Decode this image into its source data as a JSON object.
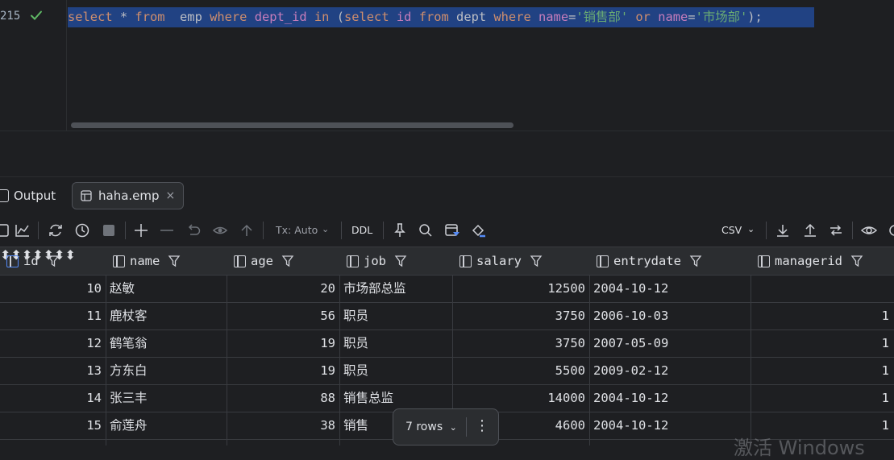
{
  "editor": {
    "line_number": "215",
    "code_tokens": [
      {
        "t": "select",
        "c": "kw"
      },
      {
        "t": " * ",
        "c": "op"
      },
      {
        "t": "from",
        "c": "kw"
      },
      {
        "t": "  emp ",
        "c": "id"
      },
      {
        "t": "where",
        "c": "kw"
      },
      {
        "t": " ",
        "c": "op"
      },
      {
        "t": "dept_id",
        "c": "fld"
      },
      {
        "t": " ",
        "c": "op"
      },
      {
        "t": "in",
        "c": "kw"
      },
      {
        "t": " (",
        "c": "op"
      },
      {
        "t": "select",
        "c": "kw"
      },
      {
        "t": " ",
        "c": "op"
      },
      {
        "t": "id",
        "c": "fld"
      },
      {
        "t": " ",
        "c": "op"
      },
      {
        "t": "from",
        "c": "kw"
      },
      {
        "t": " dept ",
        "c": "id"
      },
      {
        "t": "where",
        "c": "kw"
      },
      {
        "t": " ",
        "c": "op"
      },
      {
        "t": "name",
        "c": "fld"
      },
      {
        "t": "=",
        "c": "op"
      },
      {
        "t": "'销售部'",
        "c": "str"
      },
      {
        "t": " ",
        "c": "op"
      },
      {
        "t": "or",
        "c": "kw"
      },
      {
        "t": " ",
        "c": "op"
      },
      {
        "t": "name",
        "c": "fld"
      },
      {
        "t": "=",
        "c": "op"
      },
      {
        "t": "'市场部'",
        "c": "str"
      },
      {
        "t": ");",
        "c": "op"
      }
    ]
  },
  "tabs": {
    "output_label": "Output",
    "emp_label": "haha.emp",
    "close_glyph": "×"
  },
  "toolbar": {
    "tx_label": "Tx: Auto",
    "ddl_label": "DDL",
    "csv_label": "CSV"
  },
  "columns": [
    {
      "name": "id"
    },
    {
      "name": "name"
    },
    {
      "name": "age"
    },
    {
      "name": "job"
    },
    {
      "name": "salary"
    },
    {
      "name": "entrydate"
    },
    {
      "name": "managerid"
    }
  ],
  "rows": [
    {
      "id": "10",
      "name": "赵敏",
      "age": "20",
      "job": "市场部总监",
      "salary": "12500",
      "entrydate": "2004-10-12",
      "managerid": ""
    },
    {
      "id": "11",
      "name": "鹿杖客",
      "age": "56",
      "job": "职员",
      "salary": "3750",
      "entrydate": "2006-10-03",
      "managerid": "1"
    },
    {
      "id": "12",
      "name": "鹤笔翁",
      "age": "19",
      "job": "职员",
      "salary": "3750",
      "entrydate": "2007-05-09",
      "managerid": "1"
    },
    {
      "id": "13",
      "name": "方东白",
      "age": "19",
      "job": "职员",
      "salary": "5500",
      "entrydate": "2009-02-12",
      "managerid": "1"
    },
    {
      "id": "14",
      "name": "张三丰",
      "age": "88",
      "job": "销售总监",
      "salary": "14000",
      "entrydate": "2004-10-12",
      "managerid": "1"
    },
    {
      "id": "15",
      "name": "俞莲舟",
      "age": "38",
      "job": "销售",
      "salary": "4600",
      "entrydate": "2004-10-12",
      "managerid": "1"
    }
  ],
  "footer": {
    "rows_label": "7 rows",
    "more_glyph": "⋮"
  },
  "watermark": "激活 Windows"
}
